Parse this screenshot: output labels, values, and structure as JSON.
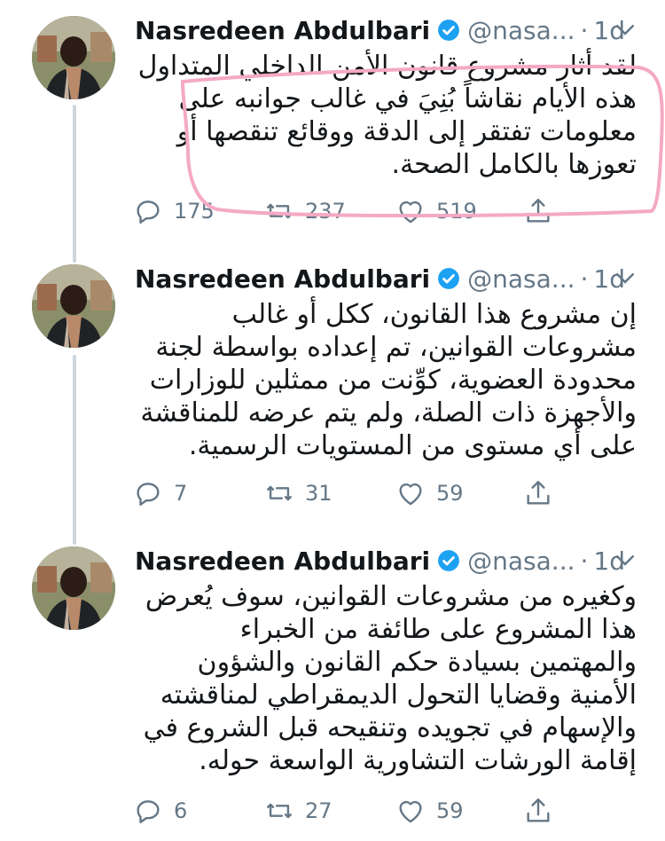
{
  "tweets": [
    {
      "name": "Nasredeen Abdulbari",
      "handle": "@nasa...",
      "time": "1d",
      "text": "لقد أثار مشروع قانون الأمن الداخلي المتداول هذه الأيام نقاشاً بُنِيَ في غالب جوانبه على معلومات تفتقر إلى الدقة ووقائع تنقصها أو تعوزها بالكامل الصحة.",
      "replies": "175",
      "retweets": "237",
      "likes": "519"
    },
    {
      "name": "Nasredeen Abdulbari",
      "handle": "@nasa...",
      "time": "1d",
      "text": "إن مشروع هذا القانون، ككل أو غالب مشروعات القوانين، تم إعداده بواسطة لجنة محدودة العضوية، كوِّنت من ممثلين للوزارات والأجهزة ذات الصلة، ولم يتم عرضه للمناقشة على أي مستوى من المستويات الرسمية.",
      "replies": "7",
      "retweets": "31",
      "likes": "59"
    },
    {
      "name": "Nasredeen Abdulbari",
      "handle": "@nasa...",
      "time": "1d",
      "text": "وكغيره من مشروعات القوانين، سوف يُعرض هذا المشروع على طائفة من الخبراء والمهتمين بسيادة حكم القانون والشؤون الأمنية وقضايا التحول الديمقراطي لمناقشته والإسهام في تجويده وتنقيحه قبل الشروع في إقامة الورشات التشاورية الواسعة حوله.",
      "replies": "6",
      "retweets": "27",
      "likes": "59"
    }
  ],
  "icons": {
    "verified": "verified-badge-icon",
    "caret": "chevron-down-icon",
    "reply": "reply-icon",
    "retweet": "retweet-icon",
    "like": "heart-icon",
    "share": "share-icon"
  },
  "colors": {
    "accent": "#1da1f2",
    "muted": "#657786",
    "thread_line": "#ccd6dd",
    "annotation": "#f4a9c4"
  }
}
